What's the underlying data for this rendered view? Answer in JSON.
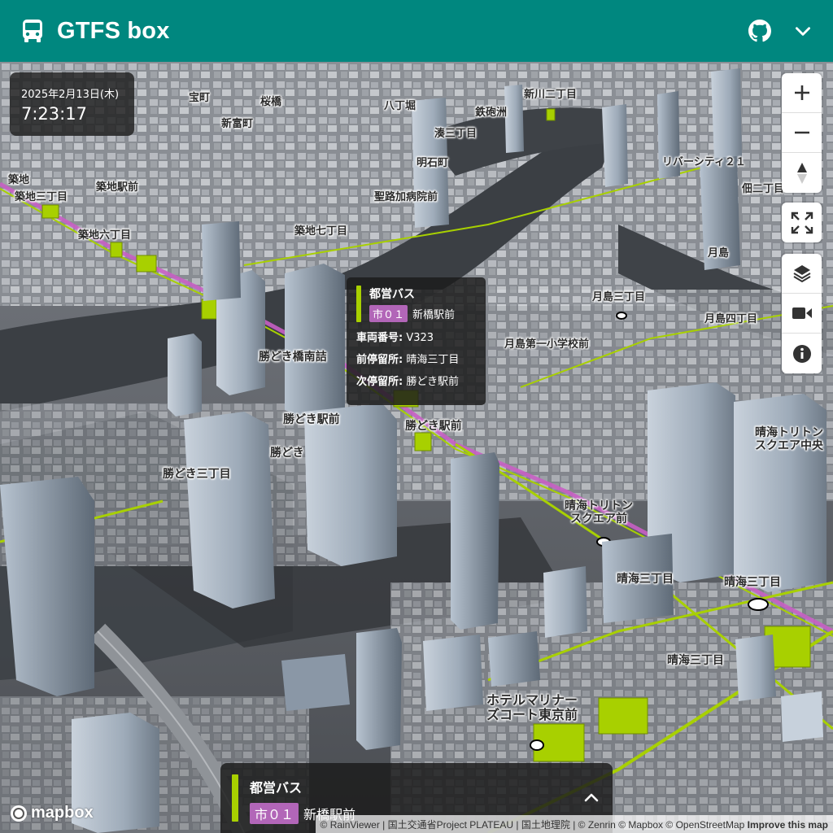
{
  "header": {
    "title": "GTFS box",
    "github_icon": "github-icon",
    "menu_icon": "chevron-down-icon",
    "bg_color": "#00877f"
  },
  "clock": {
    "date": "2025年2月13日(木)",
    "time": "7:23:17"
  },
  "map_labels": [
    {
      "text": "築地"
    },
    {
      "text": "築地三丁目"
    },
    {
      "text": "築地駅前"
    },
    {
      "text": "築地六丁目"
    },
    {
      "text": "築地七丁目"
    },
    {
      "text": "聖路加病院前"
    },
    {
      "text": "明石町"
    },
    {
      "text": "湊三丁目"
    },
    {
      "text": "鉄砲洲"
    },
    {
      "text": "八丁堀"
    },
    {
      "text": "新川二丁目"
    },
    {
      "text": "桜橋"
    },
    {
      "text": "宝町"
    },
    {
      "text": "新富町"
    },
    {
      "text": "リバーシティ２１"
    },
    {
      "text": "佃二丁目"
    },
    {
      "text": "月島"
    },
    {
      "text": "月島三丁目"
    },
    {
      "text": "月島四丁目"
    },
    {
      "text": "月島第一小学校前"
    },
    {
      "text": "勝どき橋南詰"
    },
    {
      "text": "勝どき駅前"
    },
    {
      "text": "勝どき"
    },
    {
      "text": "勝どき三丁目"
    },
    {
      "text": "晴海トリトン\nスクエア中央"
    },
    {
      "text": "晴海トリトン\nスクエア前"
    },
    {
      "text": "晴海三丁目"
    },
    {
      "text": "ホテルマリナー\nズコート東京前"
    }
  ],
  "controls": {
    "zoom_in": "plus-icon",
    "zoom_out": "minus-icon",
    "compass": "compass-icon",
    "fullscreen": "fullscreen-icon",
    "layers": "layers-icon",
    "camera": "video-camera-icon",
    "info": "info-icon"
  },
  "popup": {
    "agency": "都営バス",
    "route_short": "市０１",
    "headsign": "新橋駅前",
    "vehicle_label": "車両番号:",
    "vehicle_value": "V323",
    "prev_label": "前停留所:",
    "prev_value": "晴海三丁目",
    "next_label": "次停留所:",
    "next_value": "勝どき駅前",
    "route_color": "#b266b8",
    "agency_color": "#a8d000"
  },
  "bottom_panel": {
    "agency": "都営バス",
    "route_short": "市０１",
    "headsign": "新橋駅前"
  },
  "attribution": {
    "logo": "mapbox",
    "text": "© RainViewer | 国土交通省Project PLATEAU | 国土地理院 | © Zenrin © Mapbox © OpenStreetMap",
    "improve": "Improve this map"
  }
}
